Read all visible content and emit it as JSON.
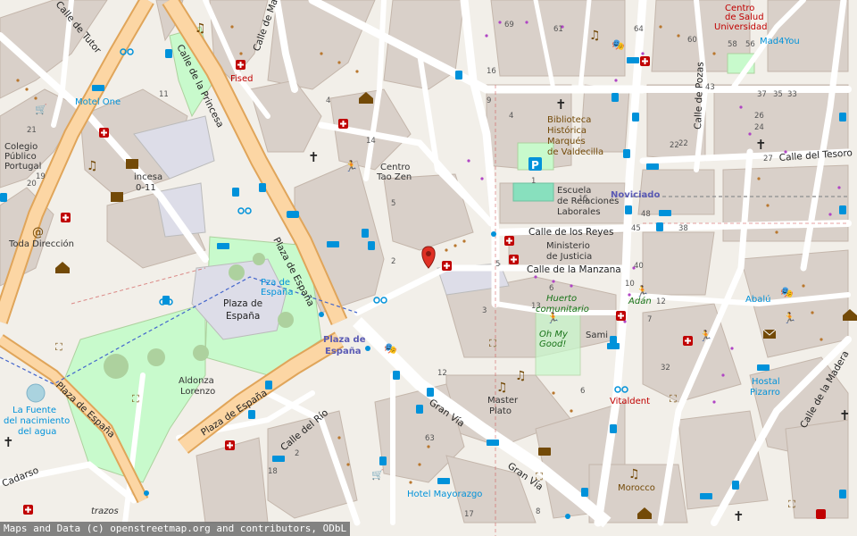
{
  "attribution": "Maps and Data (c) openstreetmap.org and contributors, ODbL",
  "streets": {
    "tutor": "Calle de Tutor",
    "manzanares": "Calle de Mart",
    "princesa": "Calle de la Princesa",
    "plaza_espana_v": "Plaza de España",
    "plaza_espana_d1": "Plaza de España",
    "plaza_espana_d2": "Plaza de España",
    "plaza_espana_w": "Plaza de España",
    "gran_via_1": "Gran Vía",
    "gran_via_2": "Gran Vía",
    "reyes": "Calle de los Reyes",
    "manzana": "Calle de la Manzana",
    "pozas": "Calle de Pozas",
    "tesoro": "Calle del Tesoro",
    "madera": "Calle de la Madera",
    "rio": "Calle del Río",
    "cadarso": "Cadarso"
  },
  "places": {
    "plaza_espana": "Plaza de España",
    "plaza_espana_metro": "Plaza de España",
    "pza_espana": "Pza de España",
    "noviciado": "Noviciado",
    "biblioteca": "Biblioteca Histórica Marqués de Valdecilla",
    "escuela": "Escuela de Relaciones Laborales",
    "ministerio": "Ministerio de Justicia",
    "centro_salud": "Centro de Salud Universidad",
    "centro_tao": "Centro Tao Zen",
    "motel_one": "Motel One",
    "colegio": "Colegio Público Portugal",
    "toda_direccion": "Toda Dirección",
    "incesa": "incesa",
    "incesa_num": "0-11",
    "fised": "Fised",
    "huerto": "Huerto comunitario",
    "oh_my_good": "Oh My Good!",
    "sami": "Sami",
    "master_plato": "Master Plato",
    "aldonza": "Aldonza Lorenzo",
    "la_fuente": "La Fuente del nacimiento del agua",
    "adan": "Adán",
    "abalu": "Abalú",
    "vitaldent": "Vitaldent",
    "hostal_pizarro": "Hostal Pizarro",
    "hotel_mayorazgo": "Hotel Mayorazgo",
    "morocco": "Morocco",
    "mad4you": "Mad4You",
    "trazos": "trazos"
  },
  "house_numbers": [
    "69",
    "61",
    "64",
    "60",
    "58",
    "56",
    "43",
    "37",
    "35",
    "33",
    "26",
    "24",
    "22",
    "27",
    "21",
    "20",
    "19",
    "11",
    "14",
    "4",
    "6",
    "7",
    "5",
    "2",
    "1",
    "3",
    "40",
    "10",
    "12",
    "32",
    "22",
    "63",
    "2",
    "5",
    "18",
    "12",
    "13",
    "15",
    "38",
    "48",
    "45",
    "6",
    "4",
    "9",
    "8",
    "16",
    "17"
  ],
  "colors": {
    "background": "#f2efe9",
    "building": "#d9d0c9",
    "building_stroke": "#c4b6ab",
    "road": "#ffffff",
    "primary_road": "#fcd6a4",
    "primary_casing": "#e0a55a",
    "park": "#c8facc",
    "park_dark": "#add19e",
    "pedestrian": "#dddde8",
    "metro_stop": "#0092da",
    "poi_red": "#c00000",
    "poi_brown": "#734a08",
    "poi_green": "#187318",
    "pitch": "#88e0be",
    "attribution_bg": "#6e6e6e"
  },
  "marker": {
    "name": "location-pin",
    "color": "#e03024"
  }
}
